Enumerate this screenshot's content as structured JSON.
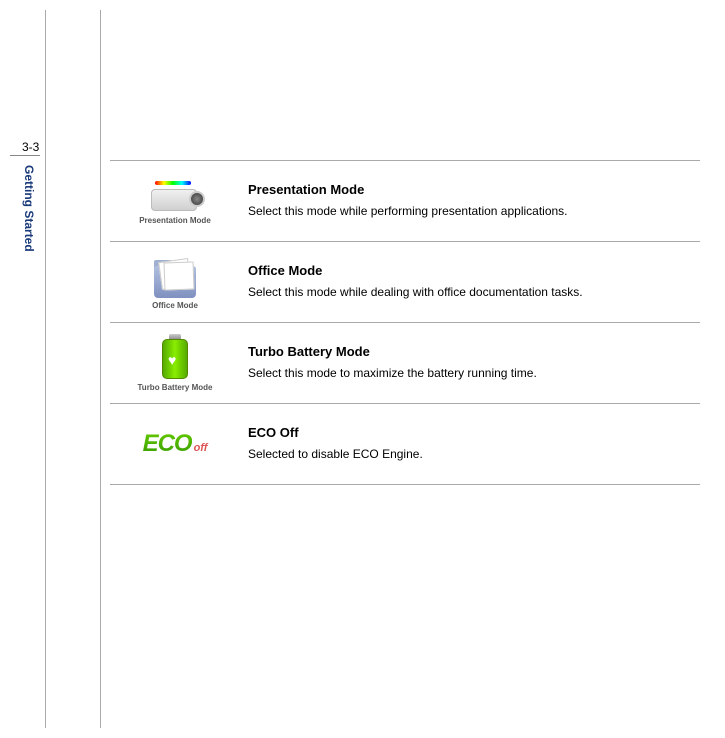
{
  "page_number": "3-3",
  "section_title": "Getting Started",
  "modes": [
    {
      "title": "Presentation Mode",
      "description": "Select this mode while performing presentation applications.",
      "icon_caption": "Presentation Mode"
    },
    {
      "title": "Office Mode",
      "description": "Select this mode while dealing with office documentation tasks.",
      "icon_caption": "Office Mode"
    },
    {
      "title": "Turbo Battery Mode",
      "description": "Select this mode to maximize the battery running time.",
      "icon_caption": "Turbo Battery Mode"
    },
    {
      "title": "ECO Off",
      "description": "Selected to disable ECO Engine.",
      "icon_caption": ""
    }
  ],
  "eco_icon": {
    "eco": "ECO",
    "off": "off"
  }
}
